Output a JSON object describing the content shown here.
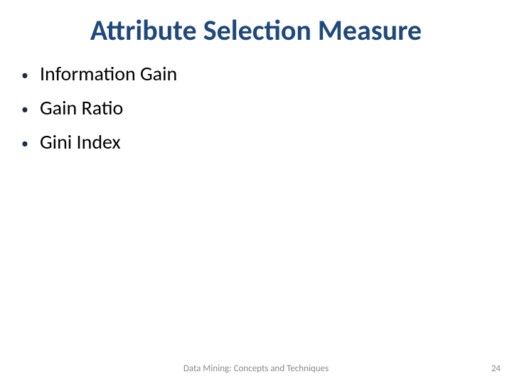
{
  "title": "Attribute Selection Measure",
  "bullets": [
    "Information Gain",
    "Gain Ratio",
    "Gini Index"
  ],
  "footer": "Data Mining: Concepts and Techniques",
  "page_number": "24"
}
